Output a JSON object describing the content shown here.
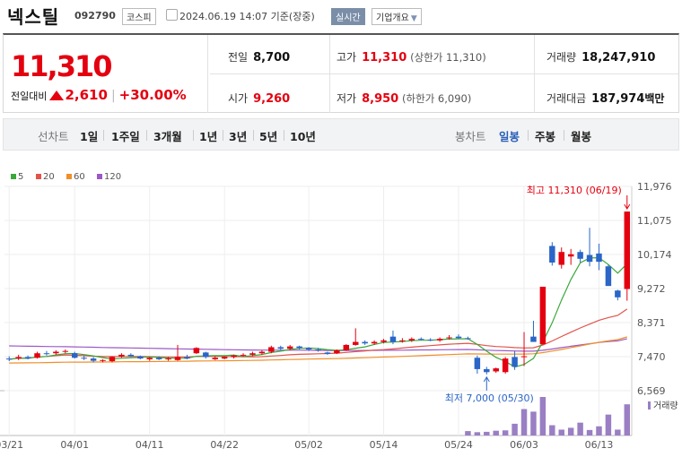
{
  "header": {
    "name": "넥스틸",
    "code": "092790",
    "market": "코스피",
    "datetime": "2024.06.19 14:07 기준(장중)",
    "realtime": "실시간",
    "company_info": "기업개요"
  },
  "summary": {
    "price": "11,310",
    "change_label": "전일대비",
    "change": "2,610",
    "change_pct": "+30.00%",
    "prev_close_label": "전일",
    "prev_close": "8,700",
    "open_label": "시가",
    "open": "9,260",
    "high_label": "고가",
    "high": "11,310",
    "upper_limit": "(상한가 11,310)",
    "low_label": "저가",
    "low": "8,950",
    "lower_limit": "(하한가 6,090)",
    "volume_label": "거래량",
    "volume": "18,247,910",
    "amount_label": "거래대금",
    "amount": "187,974",
    "amount_unit": "백만"
  },
  "period_bar": {
    "line_label": "선차트",
    "line_periods": [
      "1일",
      "1주일",
      "3개월",
      "1년",
      "3년",
      "5년",
      "10년"
    ],
    "candle_label": "봉차트",
    "candle_periods": [
      "일봉",
      "주봉",
      "월봉"
    ],
    "selected_candle": "일봉"
  },
  "colors": {
    "up": "#e4000f",
    "down": "#2a65c7",
    "ma5": "#3aa83a",
    "ma20": "#e2534b",
    "ma60": "#ef8f2a",
    "ma120": "#9b59c7",
    "volume": "#9a7fc4"
  },
  "chart_data": {
    "type": "candlestick",
    "legend": [
      "5",
      "20",
      "60",
      "120"
    ],
    "y_ticks": [
      "11,976",
      "11,075",
      "10,174",
      "9,272",
      "8,371",
      "7,470",
      "6,569"
    ],
    "ylim": [
      6569,
      11976
    ],
    "x_ticks": [
      {
        "i": 0,
        "label": "03/21"
      },
      {
        "i": 7,
        "label": "04/01"
      },
      {
        "i": 15,
        "label": "04/11"
      },
      {
        "i": 23,
        "label": "04/22"
      },
      {
        "i": 32,
        "label": "05/02"
      },
      {
        "i": 40,
        "label": "05/14"
      },
      {
        "i": 48,
        "label": "05/24"
      },
      {
        "i": 55,
        "label": "06/03"
      },
      {
        "i": 63,
        "label": "06/13"
      }
    ],
    "max_label": "최고 11,310 (06/19)",
    "min_label": "최저 7,000 (05/30)",
    "volume_label": "거래량",
    "candles": [
      [
        7420,
        7480,
        7350,
        7400
      ],
      [
        7420,
        7520,
        7380,
        7460
      ],
      [
        7460,
        7500,
        7400,
        7420
      ],
      [
        7440,
        7600,
        7420,
        7560
      ],
      [
        7560,
        7620,
        7500,
        7540
      ],
      [
        7560,
        7640,
        7520,
        7600
      ],
      [
        7600,
        7660,
        7560,
        7620
      ],
      [
        7560,
        7600,
        7420,
        7440
      ],
      [
        7440,
        7500,
        7380,
        7420
      ],
      [
        7420,
        7460,
        7320,
        7360
      ],
      [
        7360,
        7400,
        7320,
        7380
      ],
      [
        7350,
        7480,
        7320,
        7460
      ],
      [
        7470,
        7560,
        7440,
        7520
      ],
      [
        7520,
        7560,
        7460,
        7480
      ],
      [
        7480,
        7500,
        7400,
        7420
      ],
      [
        7400,
        7460,
        7360,
        7440
      ],
      [
        7440,
        7480,
        7380,
        7400
      ],
      [
        7400,
        7460,
        7360,
        7420
      ],
      [
        7380,
        7780,
        7360,
        7460
      ],
      [
        7460,
        7520,
        7400,
        7420
      ],
      [
        7560,
        7720,
        7540,
        7700
      ],
      [
        7580,
        7600,
        7420,
        7460
      ],
      [
        7400,
        7480,
        7380,
        7440
      ],
      [
        7420,
        7480,
        7400,
        7460
      ],
      [
        7460,
        7520,
        7420,
        7500
      ],
      [
        7500,
        7560,
        7460,
        7520
      ],
      [
        7520,
        7600,
        7480,
        7560
      ],
      [
        7560,
        7640,
        7520,
        7600
      ],
      [
        7600,
        7760,
        7560,
        7720
      ],
      [
        7720,
        7760,
        7640,
        7680
      ],
      [
        7680,
        7780,
        7640,
        7740
      ],
      [
        7740,
        7760,
        7660,
        7700
      ],
      [
        7700,
        7720,
        7620,
        7660
      ],
      [
        7660,
        7700,
        7600,
        7640
      ],
      [
        7580,
        7600,
        7520,
        7540
      ],
      [
        7560,
        7660,
        7540,
        7640
      ],
      [
        7640,
        7800,
        7620,
        7780
      ],
      [
        7780,
        8220,
        7760,
        7860
      ],
      [
        7860,
        7900,
        7780,
        7820
      ],
      [
        7820,
        7900,
        7780,
        7860
      ],
      [
        7860,
        7940,
        7820,
        7900
      ],
      [
        8000,
        8160,
        7800,
        7860
      ],
      [
        7880,
        7960,
        7840,
        7900
      ],
      [
        7900,
        7980,
        7860,
        7940
      ],
      [
        7940,
        7980,
        7900,
        7920
      ],
      [
        7920,
        7960,
        7880,
        7900
      ],
      [
        7900,
        7980,
        7860,
        7940
      ],
      [
        7960,
        8040,
        7920,
        7980
      ],
      [
        8000,
        8060,
        7940,
        7960
      ],
      [
        7960,
        8000,
        7920,
        7940
      ],
      [
        7440,
        7500,
        7020,
        7140
      ],
      [
        7140,
        7200,
        7000,
        7060
      ],
      [
        7080,
        7180,
        7040,
        7160
      ],
      [
        7060,
        7460,
        7020,
        7420
      ],
      [
        7460,
        7620,
        7120,
        7200
      ],
      [
        7460,
        8120,
        7220,
        7480
      ],
      [
        8000,
        8420,
        7900,
        7860
      ],
      [
        7800,
        9320,
        7780,
        9320
      ],
      [
        10400,
        10500,
        9880,
        9960
      ],
      [
        9900,
        10360,
        9800,
        10240
      ],
      [
        10120,
        10320,
        9900,
        10180
      ],
      [
        10240,
        10300,
        9960,
        10060
      ],
      [
        10160,
        10880,
        9860,
        9980
      ],
      [
        10200,
        10460,
        9760,
        9980
      ],
      [
        9860,
        9900,
        9400,
        9340
      ],
      [
        9220,
        9240,
        8960,
        9040
      ],
      [
        9260,
        11310,
        8950,
        11310
      ]
    ],
    "volumes": [
      0,
      0,
      0,
      0,
      0,
      0,
      0,
      0,
      0,
      0,
      0,
      0,
      0,
      0,
      0,
      0,
      0,
      0,
      0,
      0,
      0,
      0,
      0,
      0,
      0,
      0,
      0,
      0,
      0,
      0,
      0,
      0,
      0,
      0,
      0,
      0,
      0,
      0,
      0,
      0,
      0,
      0,
      0,
      0,
      0,
      0,
      0,
      0,
      0,
      1.2,
      0.9,
      1,
      1.3,
      1.4,
      3.2,
      7.2,
      6.5,
      10.5,
      2.8,
      1.6,
      2.1,
      3.5,
      1.5,
      2.5,
      5.7,
      1.6,
      8.5
    ]
  }
}
